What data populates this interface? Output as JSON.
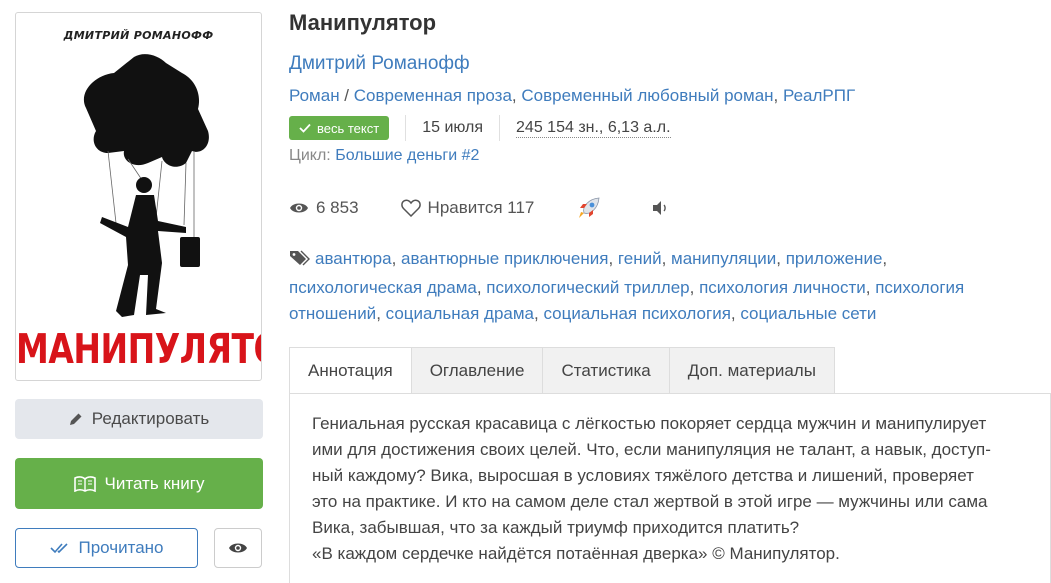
{
  "cover": {
    "author_text": "ДМИТРИЙ РОМАНОФФ",
    "title_text": "МАНИПУЛЯТОР",
    "title_color": "#d8141a"
  },
  "actions": {
    "edit_label": "Редактировать",
    "edit_icon": "pencil-icon",
    "read_label": "Читать книгу",
    "read_icon": "book-icon",
    "done_label": "Прочитано",
    "done_icon": "double-check-icon",
    "eye_icon": "eye-icon"
  },
  "book": {
    "title": "Манипулятор",
    "author": "Дмитрий Романофф",
    "genres": [
      "Роман",
      "Современная проза",
      "Современный любовный роман",
      "РеалРПГ"
    ],
    "status_badge": "весь текст",
    "date": "15 июля",
    "size": "245 154 зн., 6,13 а.л.",
    "cycle_label": "Цикл:",
    "cycle_value": "Большие деньги #2"
  },
  "stats": {
    "views": "6 853",
    "likes_label": "Нравится 117",
    "rocket_icon": "rocket-icon",
    "audio_icon": "speaker-icon"
  },
  "tags": [
    "авантюра",
    "авантюрные приключения",
    "гений",
    "манипуляции",
    "приложение",
    "психологическая драма",
    "психологический триллер",
    "психология личности",
    "психология отношений",
    "социальная драма",
    "социальная психология",
    "социальные сети"
  ],
  "tabs": [
    {
      "label": "Аннотация",
      "active": true
    },
    {
      "label": "Оглавление",
      "active": false
    },
    {
      "label": "Статистика",
      "active": false
    },
    {
      "label": "Доп. материалы",
      "active": false
    }
  ],
  "annotation": {
    "lines": [
      "Гениальная русская красавица с лёгкостью покоряет сердца мужчин и манипулирует",
      "ими для достижения своих целей. Что, если манипуляция не талант, а навык, доступ-",
      "ный каждому? Вика, выросшая в условиях тяжёлого детства и лишений, проверяет",
      "это на практике. И кто на самом деле стал жертвой в этой игре — мужчины или сама",
      "Вика, забывшая, что за каждый триумф приходится платить?",
      "«В каждом сердечке найдётся потаённая дверка» © Манипулятор."
    ]
  },
  "colors": {
    "link": "#3f7cbd",
    "green": "#66b04a",
    "edit_bg": "#e4e7ec"
  }
}
